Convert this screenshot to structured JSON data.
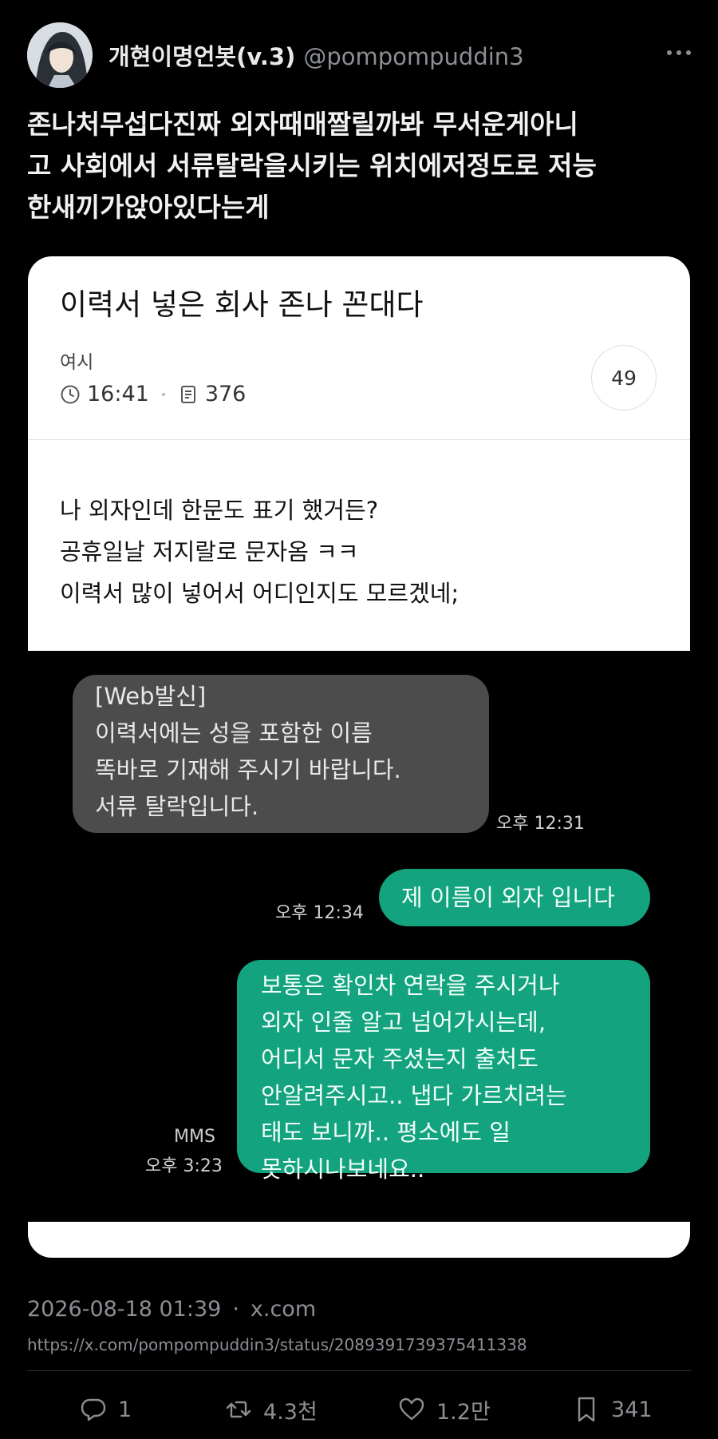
{
  "tweet": {
    "display_name": "개현이명언봇(v.3)",
    "handle": "@pompompuddin3",
    "text": "존나처무섭다진짜 외자때매짤릴까봐 무서운게아니\n고 사회에서 서류탈락을시키는 위치에저정도로 저능\n한새끼가앉아있다는게",
    "timestamp": "2026-08-18 01:39",
    "separator": "·",
    "source": "x.com",
    "url": "https://x.com/pompompuddin3/status/2089391739375411338"
  },
  "card": {
    "title": "이력서 넣은 회사 존나 꼰대다",
    "author": "여시",
    "time": "16:41",
    "views": "376",
    "comments": "49",
    "body": "나 외자인데 한문도 표기 했거든?\n공휴일날 저지랄로 문자옴 ㅋㅋ\n이력서 많이 넣어서 어디인지도 모르겠네;"
  },
  "sms": {
    "incoming": "[Web발신]\n이력서에는 성을 포함한 이름\n똑바로 기재해 주시기 바랍니다.\n서류 탈락입니다.",
    "incoming_time": "오후 12:31",
    "reply1": "제 이름이 외자 입니다",
    "reply1_time": "오후 12:34",
    "reply2": "보통은 확인차 연락을 주시거나\n외자 인줄 알고 넘어가시는데,\n어디서 문자 주셨는지 출처도\n안알려주시고.. 냅다 가르치려는\n태도 보니까.. 평소에도 일\n못하시나보네요..",
    "reply2_label": "MMS",
    "reply2_time": "오후 3:23"
  },
  "actions": {
    "replies": "1",
    "retweets": "4.3천",
    "likes": "1.2만",
    "bookmarks": "341"
  },
  "icons": {
    "clock": "clock-icon",
    "document": "document-icon",
    "reply": "reply-icon",
    "retweet": "retweet-icon",
    "like": "heart-icon",
    "bookmark": "bookmark-icon",
    "more": "more-icon"
  },
  "colors": {
    "background": "#000000",
    "bubble_incoming": "#4c4c4c",
    "bubble_outgoing": "#14a37f",
    "muted_text": "#8b8f94"
  }
}
